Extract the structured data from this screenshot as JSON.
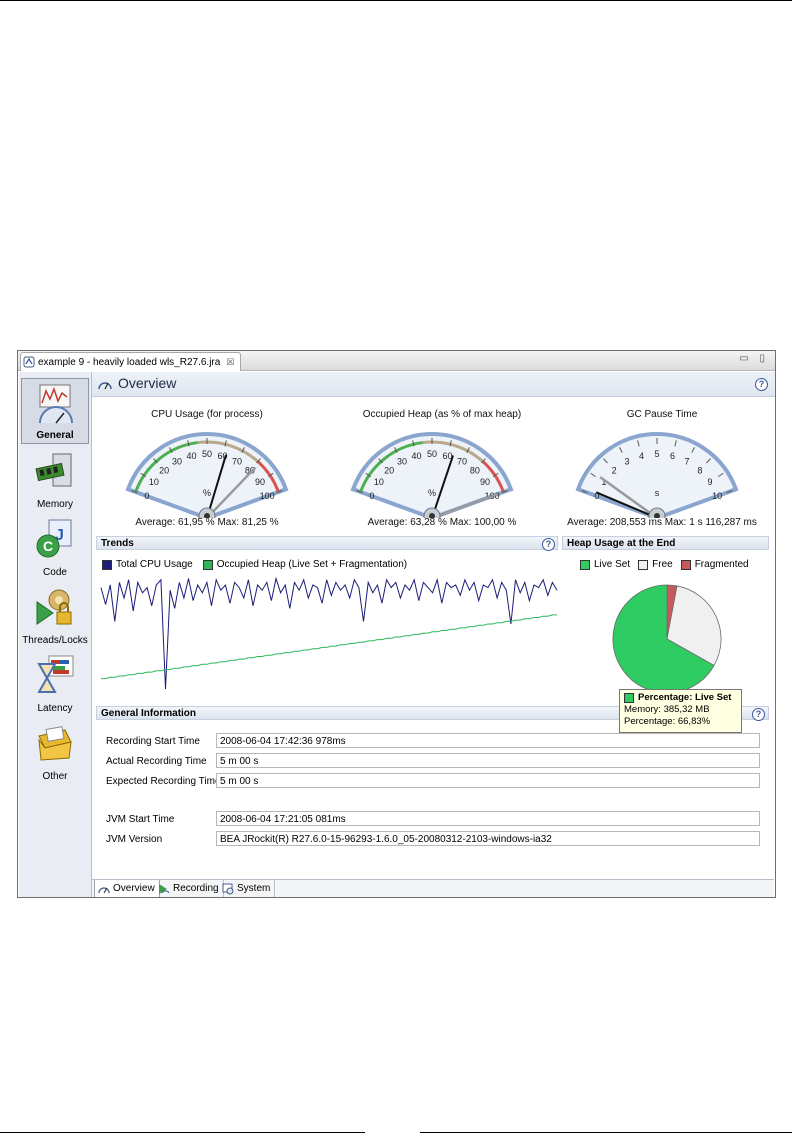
{
  "window": {
    "tab_title": "example 9 - heavily loaded wls_R27.6.jra",
    "tab_close": "☒",
    "controls": "▭ ▯"
  },
  "sidebar": {
    "items": [
      {
        "label": "General",
        "icon": "general-gauge-icon"
      },
      {
        "label": "Memory",
        "icon": "memory-chip-icon"
      },
      {
        "label": "Code",
        "icon": "code-icon"
      },
      {
        "label": "Threads/Locks",
        "icon": "threads-locks-icon"
      },
      {
        "label": "Latency",
        "icon": "latency-hourglass-icon"
      },
      {
        "label": "Other",
        "icon": "other-folder-icon"
      }
    ]
  },
  "header": {
    "title": "Overview",
    "help": "?"
  },
  "gauges": [
    {
      "title": "CPU Usage (for process)",
      "unit": "%",
      "ticks": [
        "0",
        "10",
        "20",
        "30",
        "40",
        "50",
        "60",
        "70",
        "80",
        "90",
        "100"
      ],
      "needle_avg": 61.95,
      "needle_max": 81.25,
      "range_max": 100,
      "stats": "Average: 61,95 %   Max: 81,25 %"
    },
    {
      "title": "Occupied Heap (as % of max heap)",
      "unit": "%",
      "ticks": [
        "0",
        "10",
        "20",
        "30",
        "40",
        "50",
        "60",
        "70",
        "80",
        "90",
        "100"
      ],
      "needle_avg": 63.28,
      "needle_max": 100,
      "range_max": 100,
      "stats": "Average: 63,28 %   Max: 100,00 %"
    },
    {
      "title": "GC Pause Time",
      "unit": "s",
      "ticks": [
        "0",
        "1",
        "2",
        "3",
        "4",
        "5",
        "6",
        "7",
        "8",
        "9",
        "10"
      ],
      "needle_avg": 0.21,
      "needle_max": 1.12,
      "range_max": 10,
      "stats": "Average: 208,553 ms   Max: 1 s 116,287 ms"
    }
  ],
  "trends": {
    "title": "Trends",
    "help": "?",
    "legend": [
      {
        "label": "Total CPU Usage",
        "color": "#1c1c7a"
      },
      {
        "label": "Occupied Heap (Live Set + Fragmentation)",
        "color": "#2db65a"
      }
    ]
  },
  "heap_end": {
    "title": "Heap Usage at the End",
    "legend": [
      {
        "label": "Live Set",
        "color": "#2ecc63"
      },
      {
        "label": "Free",
        "color": "#f0f0f0"
      },
      {
        "label": "Fragmented",
        "color": "#c65a5a"
      }
    ]
  },
  "chart_data": [
    {
      "type": "line",
      "title": "Trends",
      "series": [
        {
          "name": "Total CPU Usage",
          "values": [
            88,
            75,
            90,
            62,
            92,
            80,
            94,
            70,
            92,
            84,
            88,
            74,
            90,
            94,
            10,
            86,
            72,
            92,
            80,
            95,
            78,
            90,
            84,
            92,
            74,
            94,
            86,
            90,
            76,
            92,
            88,
            80,
            94,
            74,
            90,
            86,
            92,
            78,
            95,
            84,
            90,
            72,
            92,
            86,
            94,
            80,
            90,
            88,
            76,
            94,
            82,
            92,
            86,
            90,
            80,
            94,
            88,
            62,
            92,
            84,
            90,
            76,
            94,
            88,
            92,
            80,
            90,
            86,
            94,
            78,
            92,
            88,
            84,
            94,
            76,
            92,
            88,
            90,
            82,
            94,
            86,
            92,
            78,
            90,
            88,
            94,
            80,
            92,
            86,
            60,
            94,
            84,
            92,
            78,
            90,
            88,
            94,
            82,
            92,
            86
          ]
        },
        {
          "name": "Occupied Heap (Live Set + Fragmentation)",
          "values": [
            18,
            18,
            19,
            19,
            20,
            20,
            21,
            21,
            22,
            22,
            23,
            23,
            24,
            24,
            25,
            25,
            26,
            26,
            27,
            27,
            28,
            28,
            29,
            29,
            30,
            30,
            31,
            31,
            32,
            32,
            33,
            33,
            34,
            34,
            35,
            35,
            36,
            36,
            37,
            37,
            38,
            38,
            39,
            39,
            40,
            40,
            41,
            41,
            42,
            42,
            43,
            43,
            44,
            44,
            45,
            45,
            46,
            46,
            47,
            47,
            48,
            48,
            49,
            49,
            50,
            50,
            51,
            51,
            52,
            52,
            53,
            53,
            54,
            54,
            55,
            55,
            56,
            56,
            57,
            57,
            58,
            58,
            59,
            59,
            60,
            60,
            61,
            61,
            62,
            62,
            63,
            63,
            64,
            64,
            65,
            65,
            66,
            66,
            67,
            67
          ]
        }
      ],
      "ylim": [
        0,
        100
      ]
    },
    {
      "type": "pie",
      "title": "Heap Usage at the End",
      "categories": [
        "Live Set",
        "Free",
        "Fragmented"
      ],
      "values": [
        66.83,
        30.2,
        2.97
      ]
    }
  ],
  "tooltip": {
    "title": "Percentage: Live Set",
    "line1": "Memory: 385,32 MB",
    "line2": "Percentage: 66,83%"
  },
  "general_info": {
    "title": "General Information",
    "help": "?",
    "fields": [
      {
        "label": "Recording Start Time",
        "value": "2008-06-04 17:42:36 978ms"
      },
      {
        "label": "Actual Recording Time",
        "value": "5 m 00 s"
      },
      {
        "label": "Expected Recording Time",
        "value": "5 m 00 s"
      },
      {
        "label": "JVM Start Time",
        "value": "2008-06-04 17:21:05 081ms"
      },
      {
        "label": "JVM Version",
        "value": "BEA JRockit(R) R27.6.0-15-96293-1.6.0_05-20080312-2103-windows-ia32"
      }
    ]
  },
  "bottom_tabs": [
    {
      "label": "Overview"
    },
    {
      "label": "Recording"
    },
    {
      "label": "System"
    }
  ]
}
